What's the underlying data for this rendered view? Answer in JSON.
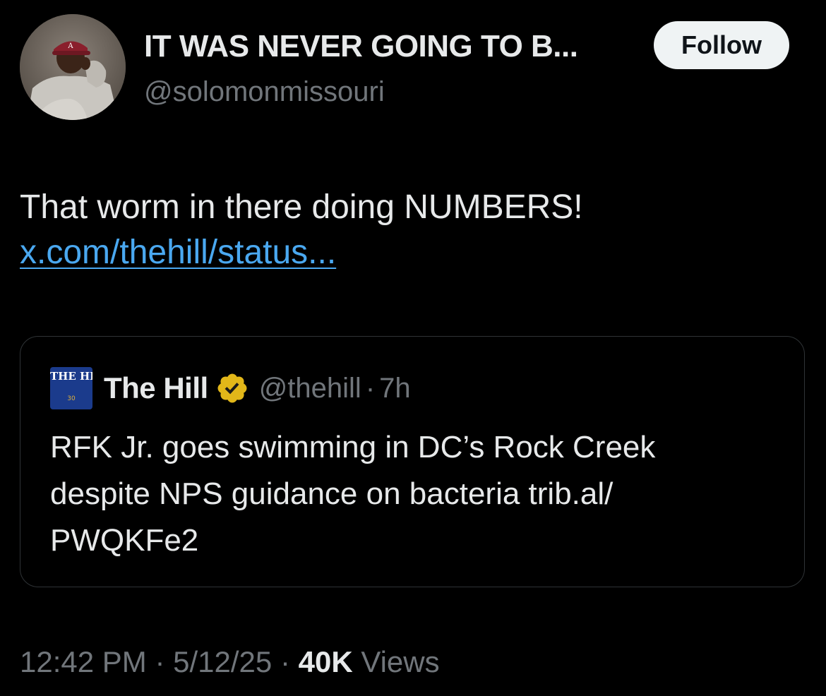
{
  "author": {
    "display_name": "IT WAS NEVER GOING TO B...",
    "handle": "@solomonmissouri",
    "avatar_icon": "user-avatar-photo"
  },
  "follow_button": {
    "label": "Follow"
  },
  "tweet": {
    "text": "That worm in there doing NUMBERS!",
    "link_text": "x.com/thehill/status..."
  },
  "quote": {
    "logo_text": "THE HILL",
    "logo_sub": "30",
    "author_name": "The Hill",
    "verified_icon": "verified-badge-icon",
    "handle": "@thehill",
    "separator": "·",
    "time": "7h",
    "text": "RFK Jr. goes swimming in DC’s Rock Creek despite NPS guidance on bacteria trib.al/ PWQKFe2"
  },
  "meta": {
    "time": "12:42 PM",
    "separator": "·",
    "date": "5/12/25",
    "views_count": "40K",
    "views_label": "Views"
  },
  "colors": {
    "background": "#000000",
    "primary_text": "#e7e9ea",
    "secondary_text": "#71767b",
    "link": "#4aa8f0",
    "verified_gold": "#e2b719",
    "border": "#2f3336"
  }
}
